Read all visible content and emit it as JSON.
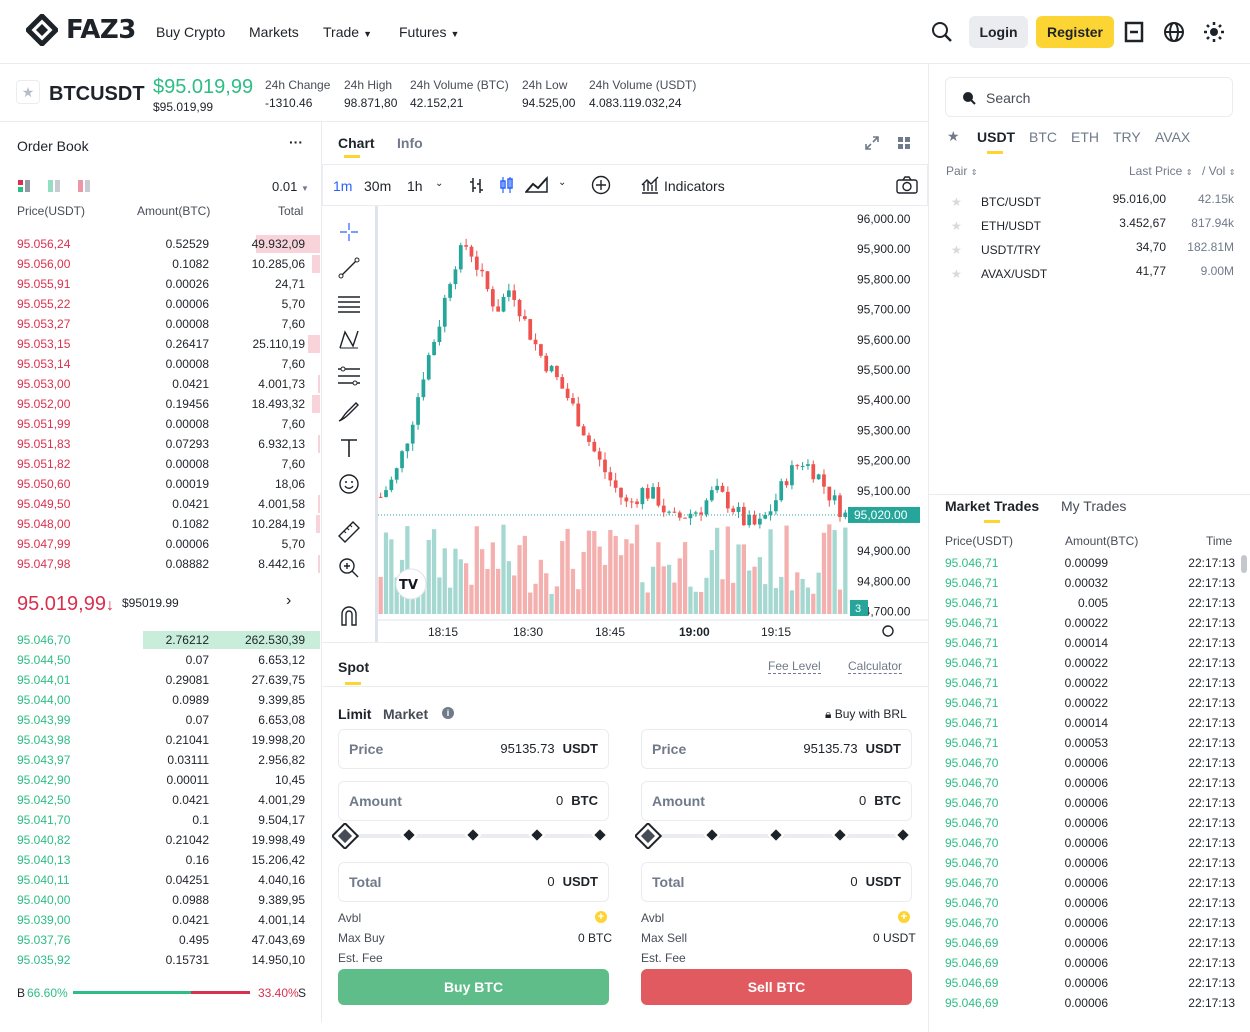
{
  "header": {
    "logo": "FAZ3",
    "nav": [
      "Buy Crypto",
      "Markets",
      "Trade",
      "Futures"
    ],
    "login": "Login",
    "register": "Register"
  },
  "ticker": {
    "symbol": "BTCUSDT",
    "price": "$95.019,99",
    "price_sub": "$95.019,99",
    "stats": [
      {
        "label": "24h Change",
        "value": "-1310.46"
      },
      {
        "label": "24h High",
        "value": "98.871,80"
      },
      {
        "label": "24h Volume (BTC)",
        "value": "42.152,21"
      },
      {
        "label": "24h Low",
        "value": "94.525,00"
      },
      {
        "label": "24h Volume (USDT)",
        "value": "4.083.119.032,24"
      }
    ]
  },
  "orderbook": {
    "title": "Order Book",
    "more": "···",
    "precision": "0.01",
    "headers": [
      "Price(USDT)",
      "Amount(BTC)",
      "Total"
    ],
    "asks": [
      [
        "95.056,24",
        "0.52529",
        "49.932,09",
        0.64
      ],
      [
        "95.056,00",
        "0.1082",
        "10.285,06",
        0.08
      ],
      [
        "95.055,91",
        "0.00026",
        "24,71",
        0
      ],
      [
        "95.055,22",
        "0.00006",
        "5,70",
        0
      ],
      [
        "95.053,27",
        "0.00008",
        "7,60",
        0
      ],
      [
        "95.053,15",
        "0.26417",
        "25.110,19",
        0.12
      ],
      [
        "95.053,14",
        "0.00008",
        "7,60",
        0
      ],
      [
        "95.053,00",
        "0.0421",
        "4.001,73",
        0.02
      ],
      [
        "95.052,00",
        "0.19456",
        "18.493,32",
        0.08
      ],
      [
        "95.051,99",
        "0.00008",
        "7,60",
        0
      ],
      [
        "95.051,83",
        "0.07293",
        "6.932,13",
        0.02
      ],
      [
        "95.051,82",
        "0.00008",
        "7,60",
        0
      ],
      [
        "95.050,60",
        "0.00019",
        "18,06",
        0
      ],
      [
        "95.049,50",
        "0.0421",
        "4.001,58",
        0.02
      ],
      [
        "95.048,00",
        "0.1082",
        "10.284,19",
        0.04
      ],
      [
        "95.047,99",
        "0.00006",
        "5,70",
        0
      ],
      [
        "95.047,98",
        "0.08882",
        "8.442,16",
        0.02
      ]
    ],
    "mid_price": "95.019,99",
    "mid_arrow": "↓",
    "mid_sub": "$95019.99",
    "bids": [
      [
        "95.046,70",
        "2.76212",
        "262.530,39",
        0.55
      ],
      [
        "95.044,50",
        "0.07",
        "6.653,12",
        0
      ],
      [
        "95.044,01",
        "0.29081",
        "27.639,75",
        0
      ],
      [
        "95.044,00",
        "0.0989",
        "9.399,85",
        0
      ],
      [
        "95.043,99",
        "0.07",
        "6.653,08",
        0
      ],
      [
        "95.043,98",
        "0.21041",
        "19.998,20",
        0
      ],
      [
        "95.043,97",
        "0.03111",
        "2.956,82",
        0
      ],
      [
        "95.042,90",
        "0.00011",
        "10,45",
        0
      ],
      [
        "95.042,50",
        "0.0421",
        "4.001,29",
        0
      ],
      [
        "95.041,70",
        "0.1",
        "9.504,17",
        0
      ],
      [
        "95.040,82",
        "0.21042",
        "19.998,49",
        0
      ],
      [
        "95.040,13",
        "0.16",
        "15.206,42",
        0
      ],
      [
        "95.040,11",
        "0.04251",
        "4.040,16",
        0
      ],
      [
        "95.040,00",
        "0.0988",
        "9.389,95",
        0
      ],
      [
        "95.039,00",
        "0.0421",
        "4.001,14",
        0
      ],
      [
        "95.037,76",
        "0.495",
        "47.043,69",
        0
      ],
      [
        "95.035,92",
        "0.15731",
        "14.950,10",
        0
      ]
    ],
    "ratio": {
      "b_label": "B",
      "b": "66.60%",
      "s": "33.40%",
      "s_label": "S",
      "b_frac": 0.666
    }
  },
  "chart": {
    "tabs": [
      "Chart",
      "Info"
    ],
    "intervals": [
      "1m",
      "30m",
      "1h"
    ],
    "indicators": "Indicators",
    "yticks": [
      "96,000.00",
      "95,900.00",
      "95,800.00",
      "95,700.00",
      "95,600.00",
      "95,500.00",
      "95,400.00",
      "95,300.00",
      "95,200.00",
      "95,100.00",
      "94,900.00",
      "94,800.00",
      "94,700.00"
    ],
    "price_tag": "95,020.00",
    "xticks": [
      "18:15",
      "18:30",
      "18:45",
      "19:00",
      "19:15"
    ],
    "badge": "3",
    "chart_data": {
      "type": "candlestick",
      "ylim": [
        94700,
        96000
      ],
      "last": 95020
    }
  },
  "spot": {
    "title": "Spot",
    "fee": "Fee Level",
    "calc": "Calculator",
    "limit": "Limit",
    "market": "Market",
    "buy_with": "Buy with BRL",
    "buy": {
      "price_label": "Price",
      "price": "95135.73",
      "price_unit": "USDT",
      "amount_label": "Amount",
      "amount": "0",
      "amount_unit": "BTC",
      "total_label": "Total",
      "total": "0",
      "total_unit": "USDT",
      "avbl": "Avbl",
      "max_label": "Max Buy",
      "max": "0 BTC",
      "fee": "Est. Fee",
      "btn": "Buy BTC"
    },
    "sell": {
      "price_label": "Price",
      "price": "95135.73",
      "price_unit": "USDT",
      "amount_label": "Amount",
      "amount": "0",
      "amount_unit": "BTC",
      "total_label": "Total",
      "total": "0",
      "total_unit": "USDT",
      "avbl": "Avbl",
      "max_label": "Max Sell",
      "max": "0 USDT",
      "fee": "Est. Fee",
      "btn": "Sell BTC"
    }
  },
  "market": {
    "search": "Search",
    "tabs": [
      "USDT",
      "BTC",
      "ETH",
      "TRY",
      "AVAX"
    ],
    "headers": [
      "Pair",
      "Last Price",
      "/ Vol"
    ],
    "pairs": [
      [
        "BTC/USDT",
        "95.016,00",
        "42.15k"
      ],
      [
        "ETH/USDT",
        "3.452,67",
        "817.94k"
      ],
      [
        "USDT/TRY",
        "34,70",
        "182.81M"
      ],
      [
        "AVAX/USDT",
        "41,77",
        "9.00M"
      ]
    ]
  },
  "trades": {
    "tabs": [
      "Market Trades",
      "My Trades"
    ],
    "headers": [
      "Price(USDT)",
      "Amount(BTC)",
      "Time"
    ],
    "rows": [
      [
        "95.046,71",
        "0.00099",
        "22:17:13"
      ],
      [
        "95.046,71",
        "0.00032",
        "22:17:13"
      ],
      [
        "95.046,71",
        "0.005",
        "22:17:13"
      ],
      [
        "95.046,71",
        "0.00022",
        "22:17:13"
      ],
      [
        "95.046,71",
        "0.00014",
        "22:17:13"
      ],
      [
        "95.046,71",
        "0.00022",
        "22:17:13"
      ],
      [
        "95.046,71",
        "0.00022",
        "22:17:13"
      ],
      [
        "95.046,71",
        "0.00022",
        "22:17:13"
      ],
      [
        "95.046,71",
        "0.00014",
        "22:17:13"
      ],
      [
        "95.046,71",
        "0.00053",
        "22:17:13"
      ],
      [
        "95.046,70",
        "0.00006",
        "22:17:13"
      ],
      [
        "95.046,70",
        "0.00006",
        "22:17:13"
      ],
      [
        "95.046,70",
        "0.00006",
        "22:17:13"
      ],
      [
        "95.046,70",
        "0.00006",
        "22:17:13"
      ],
      [
        "95.046,70",
        "0.00006",
        "22:17:13"
      ],
      [
        "95.046,70",
        "0.00006",
        "22:17:13"
      ],
      [
        "95.046,70",
        "0.00006",
        "22:17:13"
      ],
      [
        "95.046,70",
        "0.00006",
        "22:17:13"
      ],
      [
        "95.046,70",
        "0.00006",
        "22:17:13"
      ],
      [
        "95.046,69",
        "0.00006",
        "22:17:13"
      ],
      [
        "95.046,69",
        "0.00006",
        "22:17:13"
      ],
      [
        "95.046,69",
        "0.00006",
        "22:17:13"
      ],
      [
        "95.046,69",
        "0.00006",
        "22:17:13"
      ]
    ]
  },
  "colors": {
    "up": "#2ebd85",
    "down": "#d9304e",
    "accent": "#fcd535"
  }
}
